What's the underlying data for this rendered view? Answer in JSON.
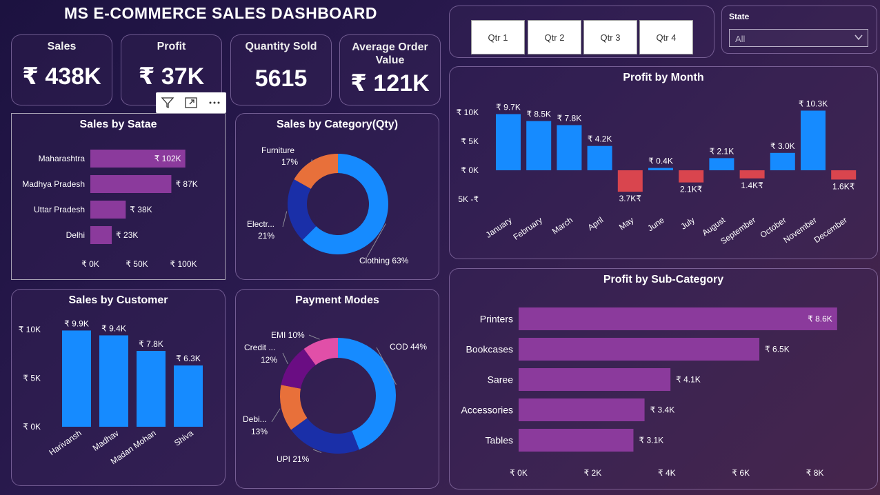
{
  "dashboard": {
    "title": "MS E-COMMERCE SALES DASHBOARD"
  },
  "kpis": [
    {
      "label": "Sales",
      "value": "₹ 438K"
    },
    {
      "label": "Profit",
      "value": "₹ 37K"
    },
    {
      "label": "Quantity Sold",
      "value": "5615"
    },
    {
      "label": "Average Order Value",
      "value": "₹ 121K"
    }
  ],
  "filters": {
    "quarters": [
      "Qtr 1",
      "Qtr 2",
      "Qtr 3",
      "Qtr 4"
    ],
    "state_label": "State",
    "state_value": "All"
  },
  "colors": {
    "purple_bar": "#8b3a9c",
    "blue": "#168bff",
    "red": "#d9454e",
    "orange": "#e8703a",
    "dark_blue": "#1a2fa8",
    "dark_purple": "#6a0d83",
    "pink": "#e14fa8"
  },
  "chart_data": [
    {
      "id": "sales_by_state",
      "type": "bar",
      "orientation": "horizontal",
      "title": "Sales by Satae",
      "categories": [
        "Maharashtra",
        "Madhya Pradesh",
        "Uttar Pradesh",
        "Delhi"
      ],
      "values": [
        102,
        87,
        38,
        23
      ],
      "value_labels": [
        "₹ 102K",
        "₹ 87K",
        "₹ 38K",
        "₹ 23K"
      ],
      "x_ticks": [
        0,
        50,
        100
      ],
      "x_tick_labels": [
        "₹ 0K",
        "₹ 50K",
        "₹ 100K"
      ],
      "xlim": [
        0,
        115
      ],
      "unit": "K"
    },
    {
      "id": "sales_by_category",
      "type": "pie",
      "donut": true,
      "title": "Sales by Category(Qty)",
      "slices": [
        {
          "name": "Clothing",
          "value": 63,
          "label": "Clothing 63%",
          "color": "#168bff"
        },
        {
          "name": "Electr...",
          "value": 21,
          "label": "21%",
          "color": "#1a2fa8"
        },
        {
          "name": "Furniture",
          "value": 17,
          "label": "17%",
          "color": "#e8703a"
        }
      ]
    },
    {
      "id": "profit_by_month",
      "type": "bar",
      "title": "Profit by Month",
      "categories": [
        "January",
        "February",
        "March",
        "April",
        "May",
        "June",
        "July",
        "August",
        "September",
        "October",
        "November",
        "December"
      ],
      "values": [
        9.7,
        8.5,
        7.8,
        4.2,
        -3.7,
        0.4,
        -2.1,
        2.1,
        -1.4,
        3.0,
        10.3,
        -1.6
      ],
      "value_labels": [
        "₹ 9.7K",
        "₹ 8.5K",
        "₹ 7.8K",
        "₹ 4.2K",
        "3.7K₹",
        "₹ 0.4K",
        "2.1K₹",
        "₹ 2.1K",
        "1.4K₹",
        "₹ 3.0K",
        "₹ 10.3K",
        "1.6K₹"
      ],
      "y_ticks": [
        10,
        5,
        0,
        -5
      ],
      "y_tick_labels": [
        "₹ 10K",
        "₹ 5K",
        "₹ 0K",
        "5K -₹"
      ],
      "ylim": [
        -5,
        10.5
      ],
      "unit": "K"
    },
    {
      "id": "sales_by_customer",
      "type": "bar",
      "title": "Sales by Customer",
      "categories": [
        "Harivansh",
        "Madhav",
        "Madan Mohan",
        "Shiva"
      ],
      "values": [
        9.9,
        9.4,
        7.8,
        6.3
      ],
      "value_labels": [
        "₹ 9.9K",
        "₹ 9.4K",
        "₹ 7.8K",
        "₹ 6.3K"
      ],
      "y_ticks": [
        10,
        5,
        0
      ],
      "y_tick_labels": [
        "₹ 10K",
        "₹ 5K",
        "₹ 0K"
      ],
      "ylim": [
        0,
        10
      ],
      "unit": "K"
    },
    {
      "id": "payment_modes",
      "type": "pie",
      "donut": true,
      "title": "Payment Modes",
      "slices": [
        {
          "name": "COD",
          "value": 44,
          "label": "COD 44%",
          "color": "#168bff"
        },
        {
          "name": "UPI",
          "value": 21,
          "label": "UPI 21%",
          "color": "#1a2fa8"
        },
        {
          "name": "Debi...",
          "value": 13,
          "label": "13%",
          "color": "#e8703a"
        },
        {
          "name": "Credit ...",
          "value": 12,
          "label": "12%",
          "color": "#6a0d83"
        },
        {
          "name": "EMI",
          "value": 10,
          "label": "EMI 10%",
          "color": "#e14fa8"
        }
      ]
    },
    {
      "id": "profit_by_subcategory",
      "type": "bar",
      "orientation": "horizontal",
      "title": "Profit by Sub-Category",
      "categories": [
        "Printers",
        "Bookcases",
        "Saree",
        "Accessories",
        "Tables"
      ],
      "values": [
        8.6,
        6.5,
        4.1,
        3.4,
        3.1
      ],
      "value_labels": [
        "₹ 8.6K",
        "₹ 6.5K",
        "₹ 4.1K",
        "₹ 3.4K",
        "₹ 3.1K"
      ],
      "x_ticks": [
        0,
        2,
        4,
        6,
        8
      ],
      "x_tick_labels": [
        "₹ 0K",
        "₹ 2K",
        "₹ 4K",
        "₹ 6K",
        "₹ 8K"
      ],
      "xlim": [
        0,
        8.6
      ],
      "unit": "K"
    }
  ]
}
